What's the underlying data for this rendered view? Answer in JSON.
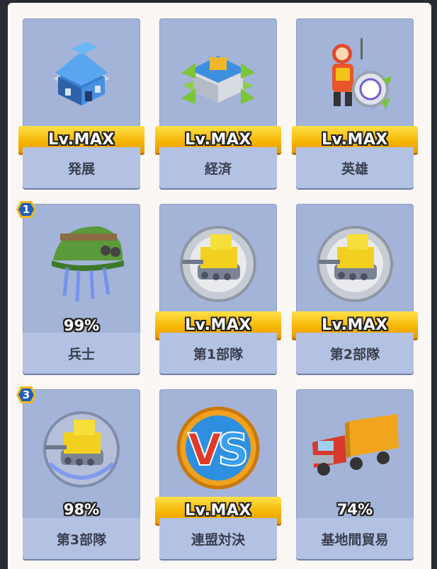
{
  "colors": {
    "panel_bg": "#faf7f5",
    "card_bg": "#a3b4d8",
    "label_bg": "#b3c2e3",
    "level_bar": "#f5b400",
    "badge": "#1f5fb8"
  },
  "cards": [
    {
      "name": "発展",
      "level": "Lv.MAX",
      "icon": "building-icon"
    },
    {
      "name": "経済",
      "level": "Lv.MAX",
      "icon": "economy-building-icon"
    },
    {
      "name": "英雄",
      "level": "Lv.MAX",
      "icon": "hero-icon"
    },
    {
      "name": "兵士",
      "progress": "99%",
      "badge": "1",
      "icon": "soldier-helmet-icon"
    },
    {
      "name": "第1部隊",
      "level": "Lv.MAX",
      "icon": "tank-icon"
    },
    {
      "name": "第2部隊",
      "level": "Lv.MAX",
      "icon": "tank-icon"
    },
    {
      "name": "第3部隊",
      "progress": "98%",
      "badge": "3",
      "icon": "tank-icon"
    },
    {
      "name": "連盟対決",
      "level": "Lv.MAX",
      "icon": "vs-icon"
    },
    {
      "name": "基地間貿易",
      "progress": "74%",
      "icon": "truck-icon"
    }
  ]
}
